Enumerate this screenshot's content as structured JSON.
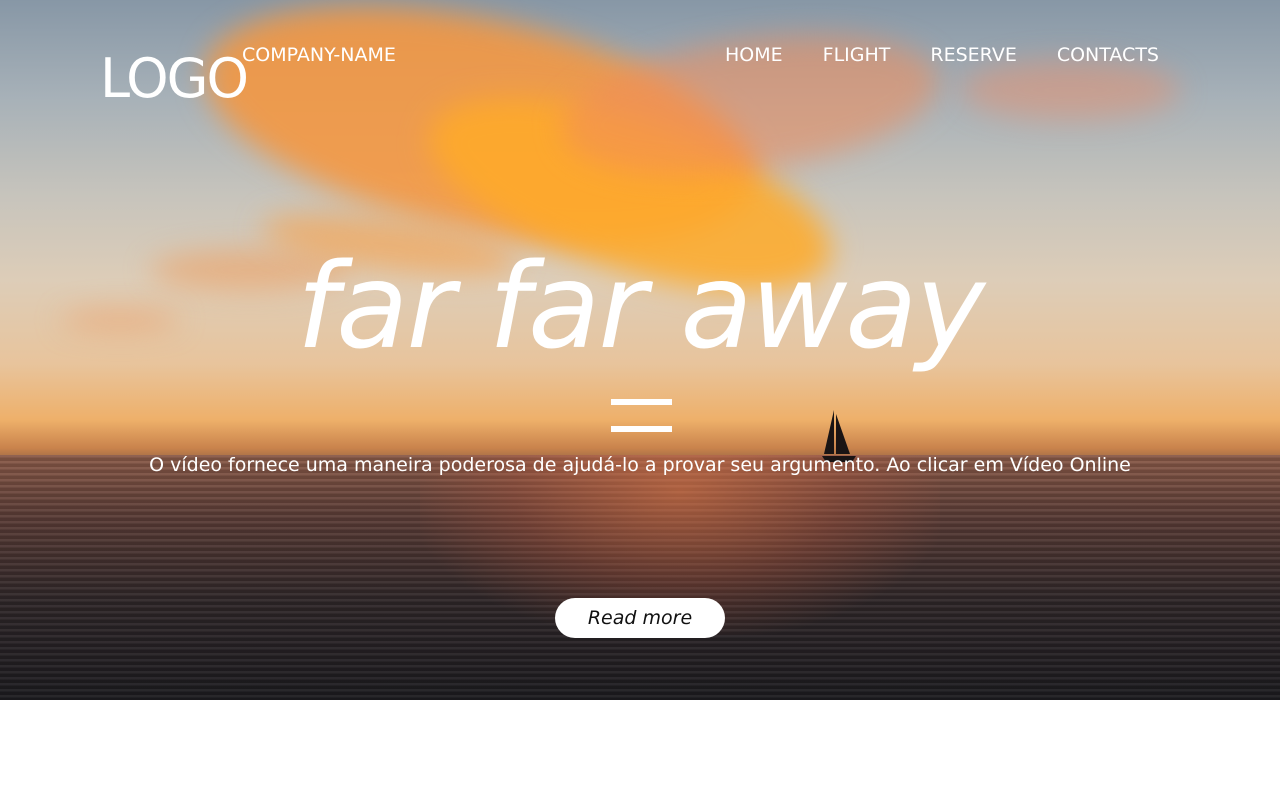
{
  "header": {
    "logo": "LOGO",
    "company_name": "COMPANY-NAME",
    "nav": [
      {
        "label": "HOME"
      },
      {
        "label": "FLIGHT"
      },
      {
        "label": "RESERVE"
      },
      {
        "label": "CONTACTS"
      }
    ]
  },
  "hero": {
    "headline": "far far away",
    "divider_icon": "equal-icon",
    "subtitle": "O vídeo fornece uma maneira poderosa de ajudá-lo a provar seu argumento. Ao clicar em Vídeo Online",
    "button_label": "Read more",
    "background": "sunset-ocean-sailboat",
    "text_color": "#ffffff",
    "button_color": "#ffffff"
  }
}
